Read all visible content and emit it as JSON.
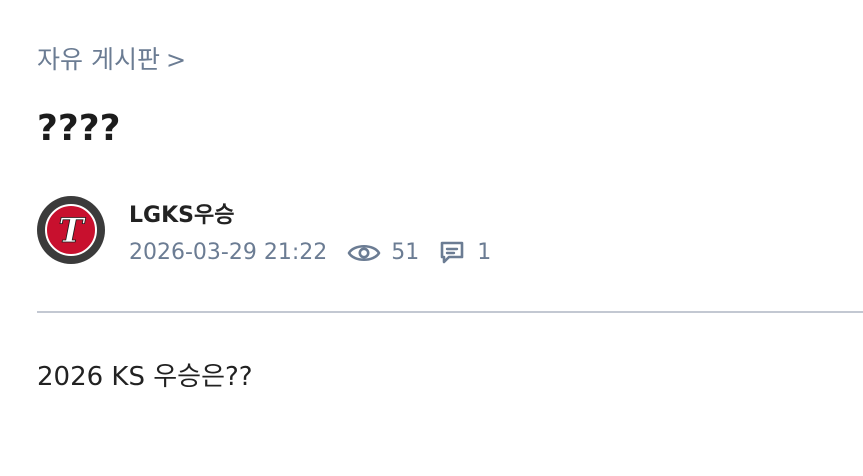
{
  "breadcrumb": {
    "board": "자유 게시판",
    "separator": ">"
  },
  "post": {
    "title": "????",
    "author": "LGKS우승",
    "avatar_letter": "T",
    "date": "2026-03-29 21:22",
    "views": "51",
    "comments": "1",
    "body": "2026 KS 우승은??"
  },
  "colors": {
    "meta_text": "#6b7c93",
    "avatar_bg": "#3b3b3b",
    "logo_red": "#c8102e",
    "divider": "#c3c8d2"
  },
  "icons": {
    "views": "eye-icon",
    "comments": "comment-icon"
  }
}
